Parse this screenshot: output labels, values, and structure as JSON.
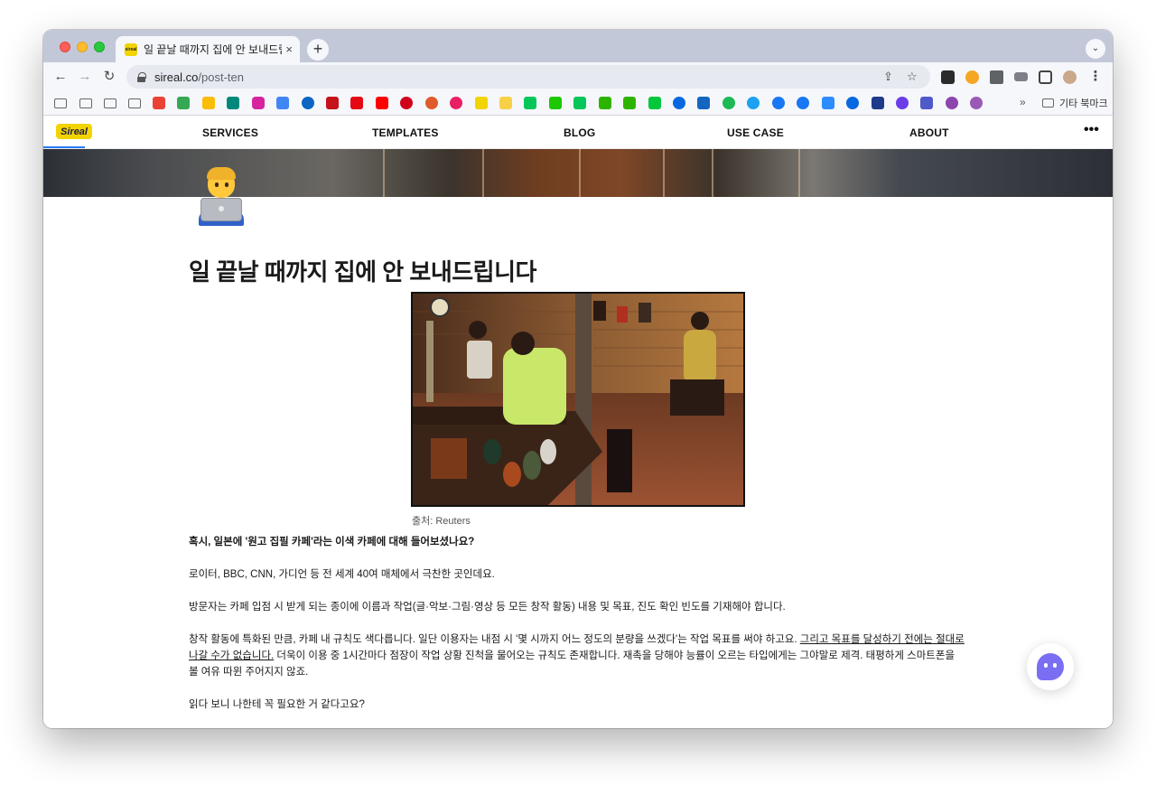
{
  "browser": {
    "tab_title": "일 끝날 때까지 집에 안 보내드립니다",
    "tab_close": "×",
    "new_tab": "+",
    "tab_search": "⌄",
    "url_host": "sireal.co",
    "url_path": "/post-ten",
    "other_bookmarks": "기타 북마크",
    "bookmarks_overflow": "»"
  },
  "site": {
    "logo": "Sireal",
    "nav": [
      "SERVICES",
      "TEMPLATES",
      "BLOG",
      "USE CASE",
      "ABOUT"
    ],
    "more": "•••"
  },
  "post": {
    "title": "일 끝날 때까지 집에 안 보내드립니다",
    "image_caption": "출처: Reuters",
    "p1": "혹시, 일본에 '원고 집필 카페'라는 이색 카페에 대해 들어보셨나요?",
    "p2": "로이터, BBC, CNN, 가디언 등 전 세계 40여 매체에서 극찬한 곳인데요.",
    "p3": "방문자는 카페 입점 시 받게 되는 종이에 이름과 작업(글·악보·그림·영상 등 모든 창작 활동) 내용 및 목표, 진도 확인 빈도를 기재해야 합니다.",
    "p4_a": "창작 활동에 특화된 만큼, 카페 내 규칙도 색다릅니다. 일단 이용자는 내점 시 '몇 시까지 어느 정도의 분량을 쓰겠다'는 작업 목표를 써야 하고요. ",
    "p4_b": "그리고 목표를 달성하기 전에는 절대로 나갈 수가 없습니다.",
    "p4_c": " 더욱이 이용 중 1시간마다 점장이 작업 상황 진척을 물어오는 규칙도 존재합니다. 재촉을 당해야 능률이 오르는 타입에게는 그야말로 제격. 태평하게 스마트폰을 볼 여유 따윈 주어지지 않죠.",
    "p5": "읽다 보니 나한테 꼭 필요한 거 같다고요?"
  },
  "colors": {
    "accent": "#2a7cf6",
    "logo_bg": "#f2d400",
    "chat": "#7a6ff2"
  }
}
